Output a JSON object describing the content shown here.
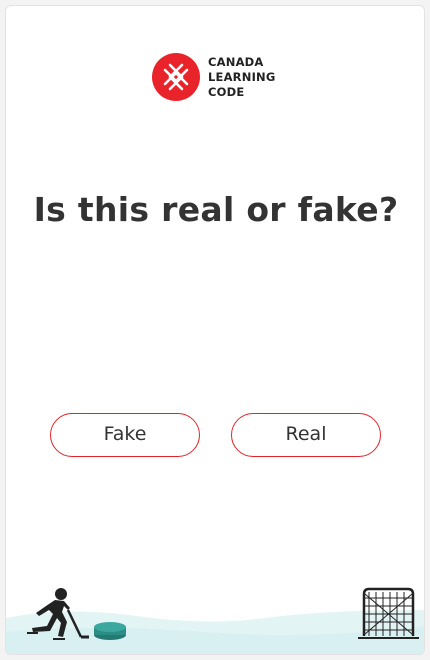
{
  "brand": {
    "name_lines": [
      "CANADA",
      "LEARNING",
      "CODE"
    ],
    "mark_color": "#e8232a",
    "icon": "canada-learning-code-mark"
  },
  "quiz": {
    "question": "Is this real or fake?",
    "options": [
      {
        "label": "Fake"
      },
      {
        "label": "Real"
      }
    ],
    "button_border_color": "#e0242b"
  },
  "footer": {
    "icons": [
      "hockey-player-icon",
      "puck-icon",
      "hockey-net-icon"
    ],
    "ice_color": "#dff3f3",
    "puck_color": "#2b8d86"
  }
}
